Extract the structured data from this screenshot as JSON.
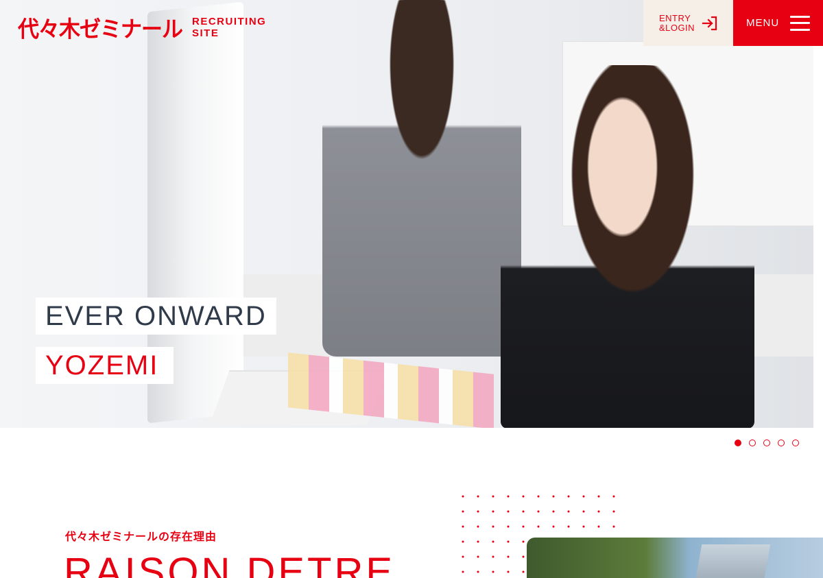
{
  "header": {
    "logo_text": "代々木ゼミナール",
    "logo_sub_line1": "RECRUITING",
    "logo_sub_line2": "SITE",
    "entry_line1": "ENTRY",
    "entry_line2": "&LOGIN",
    "menu_label": "MENU"
  },
  "hero": {
    "tagline_line1": "EVER ONWARD",
    "tagline_line2": "YOZEMI",
    "slide_count": 5,
    "active_slide": 1
  },
  "section": {
    "title_jp": "代々木ゼミナールの存在理由",
    "title_en": "RAISON DETRE"
  },
  "colors": {
    "accent": "#e60012",
    "entry_bg": "#f6efe8",
    "text_dark": "#2f3a4a"
  },
  "icons": {
    "entry": "login-arrow-icon",
    "menu": "hamburger-icon"
  }
}
